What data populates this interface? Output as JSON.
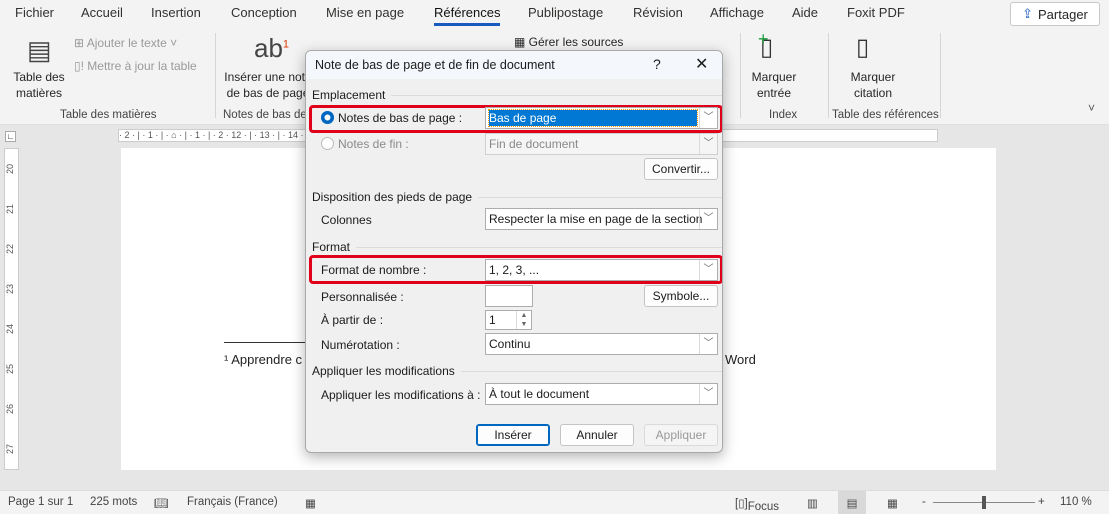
{
  "tabs": [
    {
      "label": "Fichier"
    },
    {
      "label": "Accueil"
    },
    {
      "label": "Insertion"
    },
    {
      "label": "Conception"
    },
    {
      "label": "Mise en page"
    },
    {
      "label": "Références",
      "active": true
    },
    {
      "label": "Publipostage"
    },
    {
      "label": "Révision"
    },
    {
      "label": "Affichage"
    },
    {
      "label": "Aide"
    },
    {
      "label": "Foxit PDF"
    }
  ],
  "share_label": "Partager",
  "ribbon": {
    "toc": {
      "big": "Table des matières",
      "add_text": "Ajouter le texte",
      "update": "Mettre à jour la table",
      "group": "Table des matières"
    },
    "footnotes": {
      "big": "Insérer une note de bas de page",
      "icon_text": "ab",
      "sup": "1",
      "group": "Notes de bas de page"
    },
    "citations": {
      "manage": "Gérer les sources"
    },
    "index": {
      "big": "Marquer entrée",
      "group": "Index"
    },
    "refs": {
      "big": "Marquer citation",
      "group": "Table des références"
    }
  },
  "ruler": "· 2 · | · 1 · | · ⌂ · | · 1 · | · 2 ·                                                                                                        12 · | · 13 · | · 14 · | · 15 · | · △ · | · 17 · | · 18 ·",
  "vruler": [
    "20",
    "21",
    "22",
    "23",
    "24",
    "25",
    "26",
    "27"
  ],
  "document": {
    "footnote_start": "¹ Apprendre c",
    "footnote_end": "Word"
  },
  "dialog": {
    "title": "Note de bas de page et de fin de document",
    "help": "?",
    "sections": {
      "location": "Emplacement",
      "layout": "Disposition des pieds de page",
      "format": "Format",
      "apply": "Appliquer les modifications"
    },
    "footnotes_label": "Notes de bas de page :",
    "footnotes_value": "Bas de page",
    "footnotes_selected": true,
    "endnotes_label": "Notes de fin :",
    "endnotes_value": "Fin de document",
    "convert": "Convertir...",
    "columns_label": "Colonnes",
    "columns_value": "Respecter la mise en page de la section",
    "number_format_label": "Format de nombre :",
    "number_format_value": "1, 2, 3, ...",
    "custom_label": "Personnalisée :",
    "custom_value": "",
    "symbol": "Symbole...",
    "start_label": "À partir de :",
    "start_value": "1",
    "numbering_label": "Numérotation :",
    "numbering_value": "Continu",
    "apply_to_label": "Appliquer les modifications à :",
    "apply_to_value": "À tout le document",
    "insert": "Insérer",
    "cancel": "Annuler",
    "apply_btn": "Appliquer"
  },
  "status": {
    "page": "Page 1 sur 1",
    "words": "225 mots",
    "language": "Français (France)",
    "focus": "Focus",
    "zoom": "110 %",
    "zoom_minus": "-",
    "zoom_plus": "+"
  },
  "colors": {
    "accent": "#185abd",
    "highlight": "#e0001a",
    "selection": "#0078d4"
  }
}
